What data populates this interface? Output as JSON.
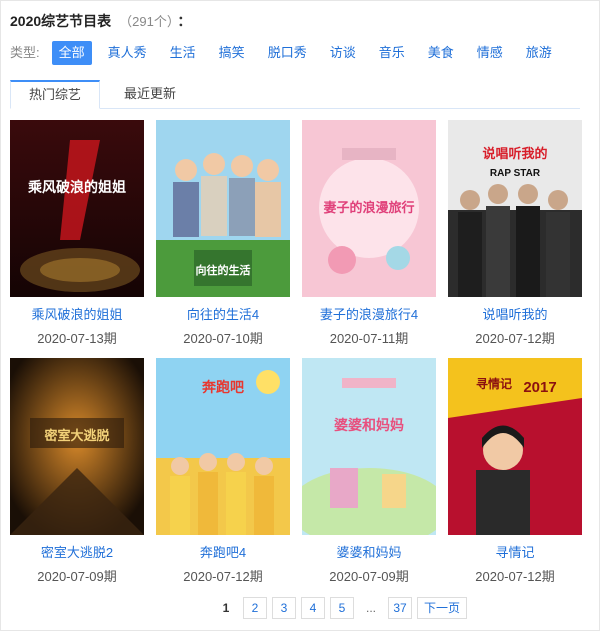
{
  "header": {
    "title": "2020综艺节目表",
    "count": "（291个）",
    "colon": "："
  },
  "filters": {
    "label": "类型:",
    "items": [
      "全部",
      "真人秀",
      "生活",
      "搞笑",
      "脱口秀",
      "访谈",
      "音乐",
      "美食",
      "情感",
      "旅游"
    ],
    "active": "全部"
  },
  "tabs": [
    {
      "label": "热门综艺",
      "active": true
    },
    {
      "label": "最近更新",
      "active": false
    }
  ],
  "shows": [
    {
      "title": "乘风破浪的姐姐",
      "date": "2020-07-13期",
      "poster_text": "乘风破浪的姐姐"
    },
    {
      "title": "向往的生活4",
      "date": "2020-07-10期",
      "poster_text": "向往的生活"
    },
    {
      "title": "妻子的浪漫旅行4",
      "date": "2020-07-11期",
      "poster_text": "妻子的浪漫旅行"
    },
    {
      "title": "说唱听我的",
      "date": "2020-07-12期",
      "poster_text": "说唱听我的",
      "poster_subtext": "RAP STAR"
    },
    {
      "title": "密室大逃脱2",
      "date": "2020-07-09期",
      "poster_text": "密室大逃脱"
    },
    {
      "title": "奔跑吧4",
      "date": "2020-07-12期",
      "poster_text": "奔跑吧"
    },
    {
      "title": "婆婆和妈妈",
      "date": "2020-07-09期",
      "poster_text": "婆婆和妈妈"
    },
    {
      "title": "寻情记",
      "date": "2020-07-12期",
      "poster_text": "寻情记",
      "poster_subtext": "2017"
    }
  ],
  "pagination": {
    "pages": [
      "1",
      "2",
      "3",
      "4",
      "5"
    ],
    "ellipsis": "...",
    "last": "37",
    "next": "下一页",
    "current": "1"
  }
}
